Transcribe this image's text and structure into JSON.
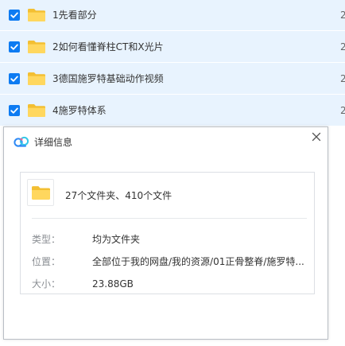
{
  "file_list": {
    "rows": [
      {
        "name": "1先看部分",
        "meta": "2",
        "checked": true
      },
      {
        "name": "2如何看懂脊柱CT和X光片",
        "meta": "2",
        "checked": true
      },
      {
        "name": "3德国施罗特基础动作视频",
        "meta": "2",
        "checked": true
      },
      {
        "name": "4施罗特体系",
        "meta": "2",
        "checked": true
      }
    ]
  },
  "dialog": {
    "title": "详细信息",
    "close_icon": "close-icon",
    "summary": "27个文件夹、410个文件",
    "properties": [
      {
        "label": "类型：",
        "value": "均为文件夹"
      },
      {
        "label": "位置：",
        "value": "全部位于我的网盘/我的资源/01正骨整脊/施罗特..."
      },
      {
        "label": "大小：",
        "value": "23.88GB"
      }
    ]
  },
  "colors": {
    "row_selected_bg": "#e8f3fe",
    "checkbox": "#0d7bf2",
    "folder": "#ffd75e",
    "folder_back": "#f3bf32"
  }
}
